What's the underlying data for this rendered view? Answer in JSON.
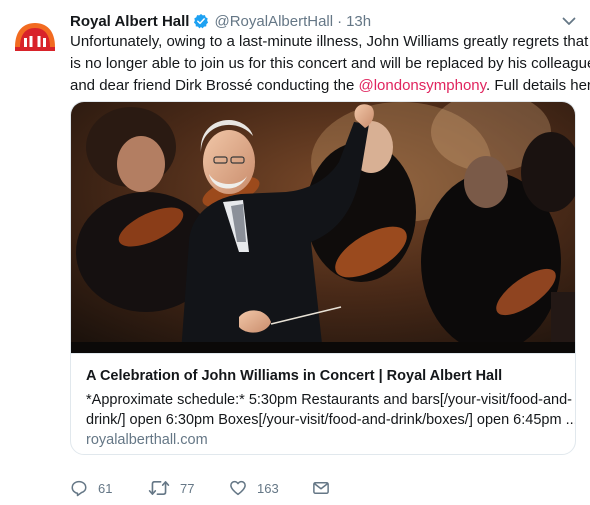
{
  "tweet": {
    "display_name": "Royal Albert Hall",
    "handle": "@RoyalAlbertHall",
    "separator": "·",
    "time": "13h",
    "text_lines": [
      {
        "pre": "Unfortunately, owing to a last-minute illness, John Williams greatly regrets that he",
        "mention": "",
        "post": ""
      },
      {
        "pre": "is no longer able to join us for this concert and will be replaced by his colleague",
        "mention": "",
        "post": ""
      },
      {
        "pre": "and dear friend Dirk Brossé conducting the ",
        "mention": "@londonsymphony",
        "post": ". Full details here:"
      }
    ]
  },
  "card": {
    "title": "A Celebration of John Williams in Concert | Royal Albert Hall",
    "description_lines": [
      "*Approximate schedule:* 5:30pm Restaurants and bars[/your-visit/food-and-",
      "drink/] open 6:30pm Boxes[/your-visit/food-and-drink/boxes/] open 6:45pm ..."
    ],
    "domain": "royalalberthall.com"
  },
  "actions": {
    "replies": "61",
    "retweets": "77",
    "likes": "163"
  },
  "colors": {
    "mention": "#e0245e",
    "secondary_text": "#657786",
    "verified": "#1da1f2",
    "logo_orange": "#f26b21",
    "logo_red": "#d8232a"
  },
  "icons": [
    "royal-albert-hall-logo-icon",
    "verified-badge-icon",
    "chevron-down-icon",
    "reply-icon",
    "retweet-icon",
    "like-heart-icon",
    "direct-message-icon"
  ]
}
